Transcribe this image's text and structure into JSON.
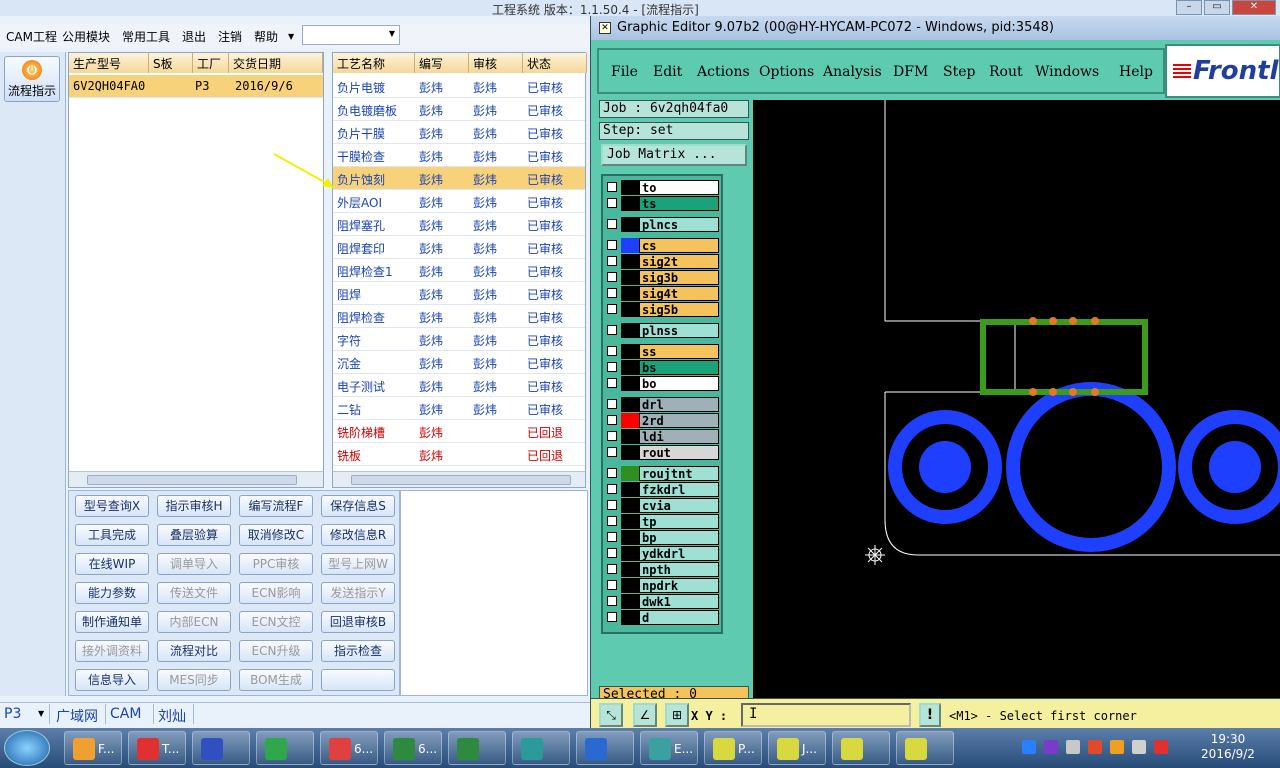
{
  "app": {
    "title": "工程系统   版本：1.1.50.4 - [流程指示]",
    "menu": [
      "CAM工程",
      "公用模块",
      "常用工具",
      "退出",
      "注销",
      "帮助"
    ],
    "combo_value": "",
    "side_button": "流程指示",
    "left_table": {
      "headers": [
        "生产型号",
        "S板",
        "工厂",
        "交货日期"
      ],
      "rows": [
        [
          "6V2QH04FA0",
          "",
          "P3",
          "2016/9/6"
        ]
      ]
    },
    "right_table": {
      "headers": [
        "工艺名称",
        "编写",
        "审核",
        "状态"
      ],
      "rows": [
        [
          "负片电镀",
          "彭炜",
          "彭炜",
          "已审核"
        ],
        [
          "负电镀磨板",
          "彭炜",
          "彭炜",
          "已审核"
        ],
        [
          "负片干膜",
          "彭炜",
          "彭炜",
          "已审核"
        ],
        [
          "干膜检查",
          "彭炜",
          "彭炜",
          "已审核"
        ],
        [
          "负片蚀刻",
          "彭炜",
          "彭炜",
          "已审核"
        ],
        [
          "外层AOI",
          "彭炜",
          "彭炜",
          "已审核"
        ],
        [
          "阻焊塞孔",
          "彭炜",
          "彭炜",
          "已审核"
        ],
        [
          "阻焊套印",
          "彭炜",
          "彭炜",
          "已审核"
        ],
        [
          "阻焊检查1",
          "彭炜",
          "彭炜",
          "已审核"
        ],
        [
          "阻焊",
          "彭炜",
          "彭炜",
          "已审核"
        ],
        [
          "阻焊检查",
          "彭炜",
          "彭炜",
          "已审核"
        ],
        [
          "字符",
          "彭炜",
          "彭炜",
          "已审核"
        ],
        [
          "沉金",
          "彭炜",
          "彭炜",
          "已审核"
        ],
        [
          "电子测试",
          "彭炜",
          "彭炜",
          "已审核"
        ],
        [
          "二钻",
          "彭炜",
          "彭炜",
          "已审核"
        ],
        [
          "铣阶梯槽",
          "彭炜",
          "",
          "已回退"
        ],
        [
          "铣板",
          "彭炜",
          "",
          "已回退"
        ]
      ]
    },
    "buttons": [
      [
        "型号查询X",
        "指示审核H",
        "编写流程F",
        "保存信息S"
      ],
      [
        "工具完成",
        "叠层验算",
        "取消修改C",
        "修改信息R"
      ],
      [
        "在线WIP",
        "调单导入",
        "PPC审核",
        "型号上网W"
      ],
      [
        "能力参数",
        "传送文件",
        "ECN影响",
        "发送指示Y"
      ],
      [
        "制作通知单",
        "内部ECN",
        "ECN文控",
        "回退审核B"
      ],
      [
        "接外调资料",
        "流程对比",
        "ECN升级",
        "指示检查"
      ],
      [
        "信息导入",
        "MES同步",
        "BOM生成",
        ""
      ]
    ],
    "disabled_buttons": [
      "调单导入",
      "PPC审核",
      "型号上网W",
      "传送文件",
      "ECN影响",
      "发送指示Y",
      "内部ECN",
      "ECN文控",
      "接外调资料",
      "ECN升级",
      "MES同步",
      "BOM生成"
    ],
    "status": [
      "P3",
      "广域网",
      "CAM",
      "刘灿"
    ]
  },
  "editor": {
    "title": "Graphic Editor 9.07b2 (00@HY-HYCAM-PC072 - Windows, pid:3548)",
    "menu": [
      "File",
      "Edit",
      "Actions",
      "Options",
      "Analysis",
      "DFM",
      "Step",
      "Rout",
      "Windows",
      "Help"
    ],
    "logo": "Frontl",
    "job": "Job : 6v2qh04fa0",
    "step": "Step: set",
    "job_matrix": "Job Matrix ...",
    "layers": [
      {
        "name": "to",
        "bg": "#ffffff",
        "color": "#000000"
      },
      {
        "name": "ts",
        "bg": "#1aa37a",
        "color": "#000000"
      },
      {
        "name": "plncs",
        "bg": "#9fe0d4",
        "color": "#000000"
      },
      {
        "name": "cs",
        "bg": "#f4c35d",
        "color": "#1f3fff"
      },
      {
        "name": "sig2t",
        "bg": "#f4c35d",
        "color": "#000000"
      },
      {
        "name": "sig3b",
        "bg": "#f4c35d",
        "color": "#000000"
      },
      {
        "name": "sig4t",
        "bg": "#f4c35d",
        "color": "#000000"
      },
      {
        "name": "sig5b",
        "bg": "#f4c35d",
        "color": "#000000"
      },
      {
        "name": "plnss",
        "bg": "#9fe0d4",
        "color": "#000000"
      },
      {
        "name": "ss",
        "bg": "#f4c35d",
        "color": "#000000"
      },
      {
        "name": "bs",
        "bg": "#1aa37a",
        "color": "#000000"
      },
      {
        "name": "bo",
        "bg": "#ffffff",
        "color": "#000000"
      },
      {
        "name": "drl",
        "bg": "#9fb0b8",
        "color": "#000000"
      },
      {
        "name": "2rd",
        "bg": "#9fb0b8",
        "color": "#ff0000"
      },
      {
        "name": "ldi",
        "bg": "#9fb0b8",
        "color": "#000000"
      },
      {
        "name": "rout",
        "bg": "#d7d7d7",
        "color": "#000000"
      },
      {
        "name": "roujtnt",
        "bg": "#9fe0d4",
        "color": "#2f8f1f"
      },
      {
        "name": "fzkdrl",
        "bg": "#9fe0d4",
        "color": "#000000"
      },
      {
        "name": "cvia",
        "bg": "#9fe0d4",
        "color": "#000000"
      },
      {
        "name": "tp",
        "bg": "#9fe0d4",
        "color": "#000000"
      },
      {
        "name": "bp",
        "bg": "#9fe0d4",
        "color": "#000000"
      },
      {
        "name": "ydkdrl",
        "bg": "#9fe0d4",
        "color": "#000000"
      },
      {
        "name": "npth",
        "bg": "#9fe0d4",
        "color": "#000000"
      },
      {
        "name": "npdrk",
        "bg": "#9fe0d4",
        "color": "#000000"
      },
      {
        "name": "dwk1",
        "bg": "#9fe0d4",
        "color": "#000000"
      },
      {
        "name": "d",
        "bg": "#9fe0d4",
        "color": "#000000"
      }
    ],
    "selected": "Selected : 0",
    "xy_label": "X Y :",
    "xy_value": "",
    "message": "<M1> - Select first corner"
  },
  "taskbar": {
    "items": [
      "F...",
      "T...",
      "",
      "",
      "6...",
      "6...",
      "",
      "",
      "",
      "E...",
      "P...",
      "J...",
      "",
      ""
    ],
    "time": "19:30",
    "date": "2016/9/2"
  }
}
